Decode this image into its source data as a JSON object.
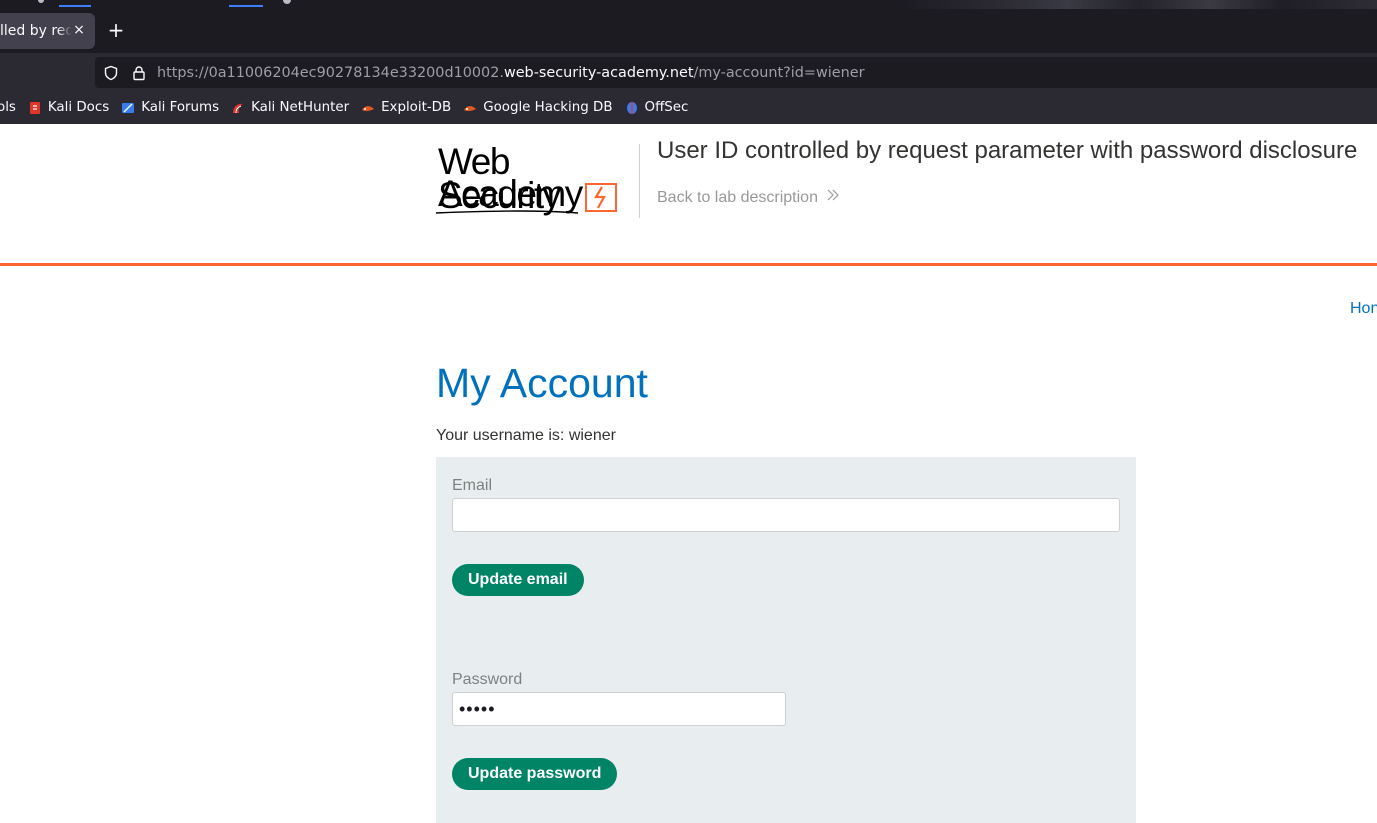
{
  "browser": {
    "tab": {
      "title": "lled by requ",
      "close_glyph": "×"
    },
    "newtab_glyph": "+",
    "url": {
      "prefix": "https://0a11006204ec90278134e33200d10002.",
      "host": "web-security-academy.net",
      "path": "/my-account?id=wiener"
    },
    "bookmarks": [
      {
        "label": "ols",
        "icon": "none"
      },
      {
        "label": "Kali Docs",
        "icon": "kali-docs-icon",
        "color": "#e0352b"
      },
      {
        "label": "Kali Forums",
        "icon": "kali-forums-icon",
        "color": "#367bf0"
      },
      {
        "label": "Kali NetHunter",
        "icon": "kali-nethunter-icon",
        "color": "#e0352b"
      },
      {
        "label": "Exploit-DB",
        "icon": "exploit-db-icon",
        "color": "#e05a22"
      },
      {
        "label": "Google Hacking DB",
        "icon": "ghdb-icon",
        "color": "#e05a22"
      },
      {
        "label": "OffSec",
        "icon": "offsec-icon",
        "color": "#367bf0"
      }
    ]
  },
  "header": {
    "logo_line1": "Web Security",
    "logo_line2": "Academy",
    "lab_title": "User ID controlled by request parameter with password disclosure",
    "back_link": "Back to lab description",
    "accent_color": "#ff6633"
  },
  "nav": {
    "home_link": "Hon"
  },
  "main": {
    "heading": "My Account",
    "username_line": "Your username is: wiener",
    "email_label": "Email",
    "email_value": "",
    "update_email_button": "Update email",
    "password_label": "Password",
    "password_value": "•••••",
    "update_password_button": "Update password",
    "button_color": "#008466"
  }
}
